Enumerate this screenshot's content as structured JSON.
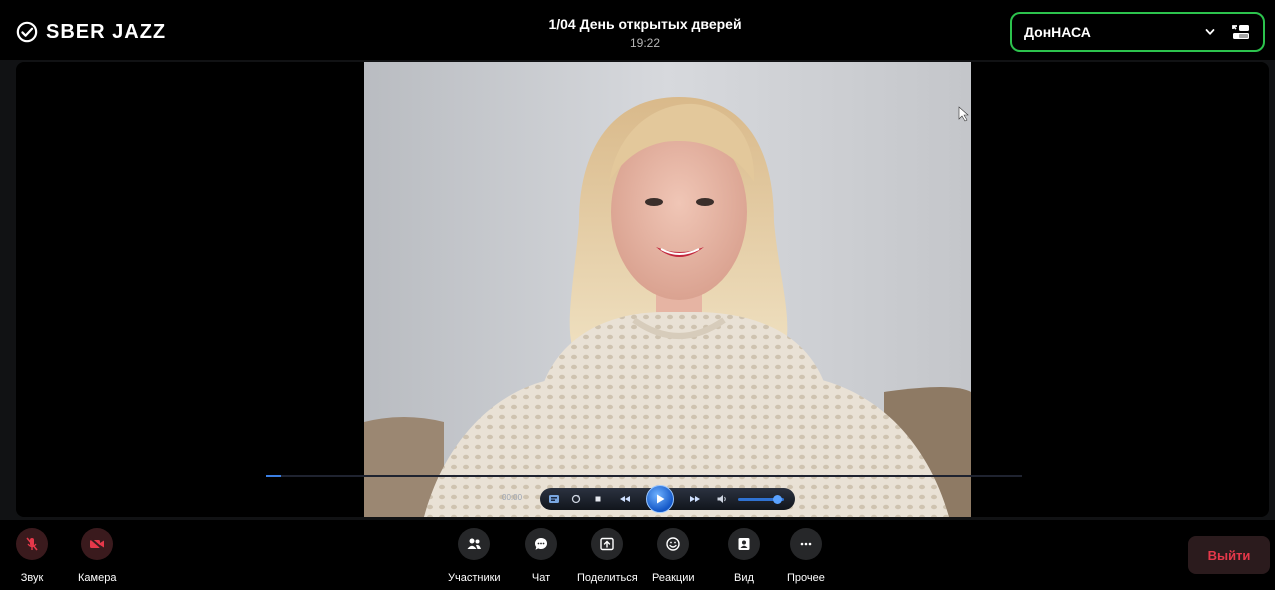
{
  "app": {
    "brand": "SBER JAZZ"
  },
  "meeting": {
    "title": "1/04 День открытых дверей",
    "time": "19:22"
  },
  "account": {
    "name": "ДонНАСА"
  },
  "player": {
    "time": "00:00",
    "progress_percent": 2,
    "volume_percent": 85
  },
  "toolbar": {
    "sound_label": "Звук",
    "camera_label": "Камера",
    "participants_label": "Участники",
    "chat_label": "Чат",
    "share_label": "Поделиться",
    "reactions_label": "Реакции",
    "view_label": "Вид",
    "more_label": "Прочее",
    "exit_label": "Выйти"
  },
  "colors": {
    "accent_green": "#2cc34d",
    "danger_red": "#e5384a",
    "toolbar_button_bg": "#262729"
  },
  "icons": {
    "brand": "sber-check-icon",
    "account_chevron": "chevron-down-icon",
    "account_switch": "switch-account-icon",
    "sound": "mic-off-icon",
    "camera": "camera-off-icon",
    "participants": "participants-icon",
    "chat": "chat-icon",
    "share": "share-screen-icon",
    "reactions": "smile-icon",
    "view": "layout-view-icon",
    "more": "more-dots-icon"
  }
}
